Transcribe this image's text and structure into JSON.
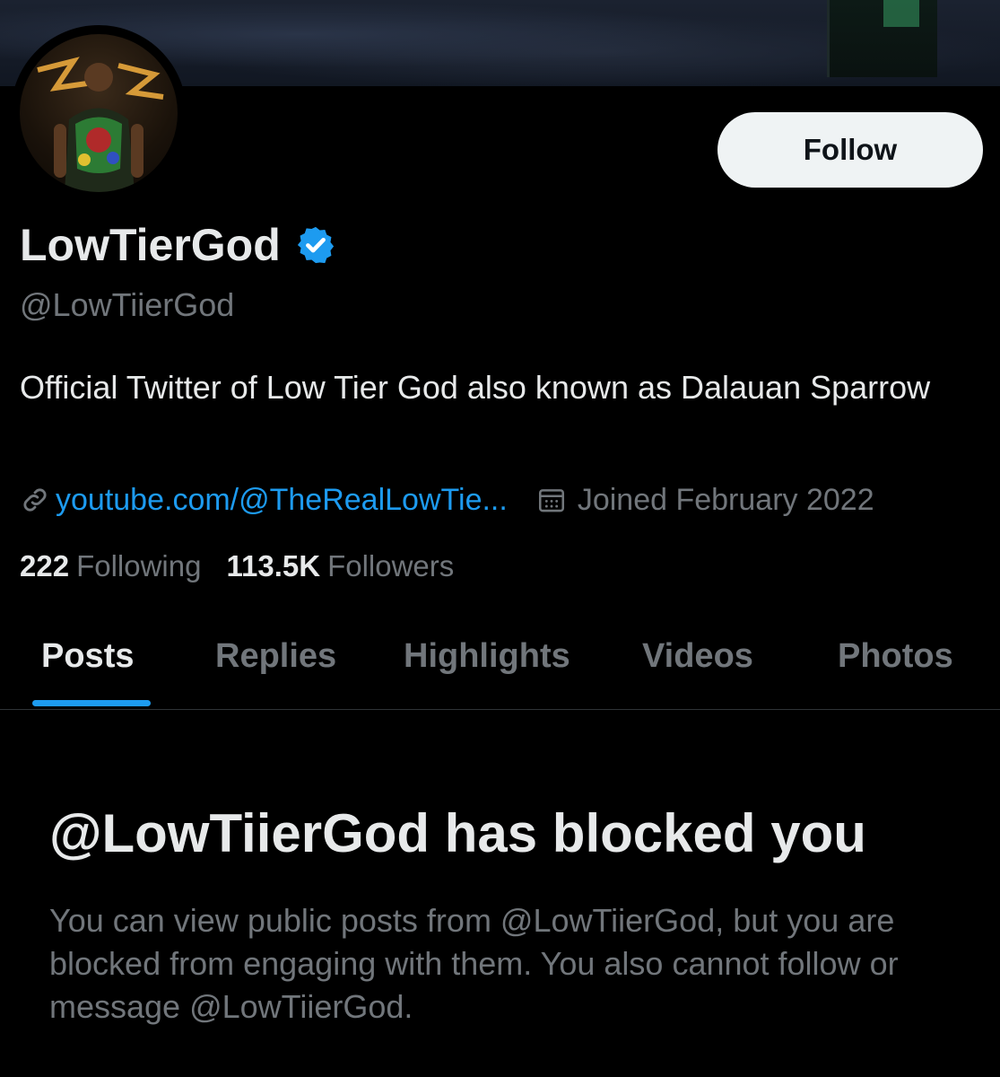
{
  "profile": {
    "display_name": "LowTierGod",
    "handle": "@LowTiierGod",
    "bio": "Official Twitter of Low Tier God also known as Dalauan Sparrow",
    "link_text": "youtube.com/@TheRealLowTie...",
    "joined": "Joined February 2022",
    "following_count": "222",
    "following_label": "Following",
    "followers_count": "113.5K",
    "followers_label": "Followers",
    "verified_icon": "verified-badge-icon"
  },
  "actions": {
    "follow_label": "Follow"
  },
  "tabs": [
    {
      "label": "Posts",
      "active": true
    },
    {
      "label": "Replies",
      "active": false
    },
    {
      "label": "Highlights",
      "active": false
    },
    {
      "label": "Videos",
      "active": false
    },
    {
      "label": "Photos",
      "active": false
    }
  ],
  "blocked": {
    "title": "@LowTiierGod has blocked you",
    "message": "You can view public posts from @LowTiierGod, but you are blocked from engaging with them. You also cannot follow or message @LowTiierGod."
  },
  "colors": {
    "background": "#000000",
    "accent": "#1d9bf0",
    "primary_text": "#e7e9ea",
    "secondary_text": "#71767b",
    "follow_button": "#eff3f4"
  }
}
